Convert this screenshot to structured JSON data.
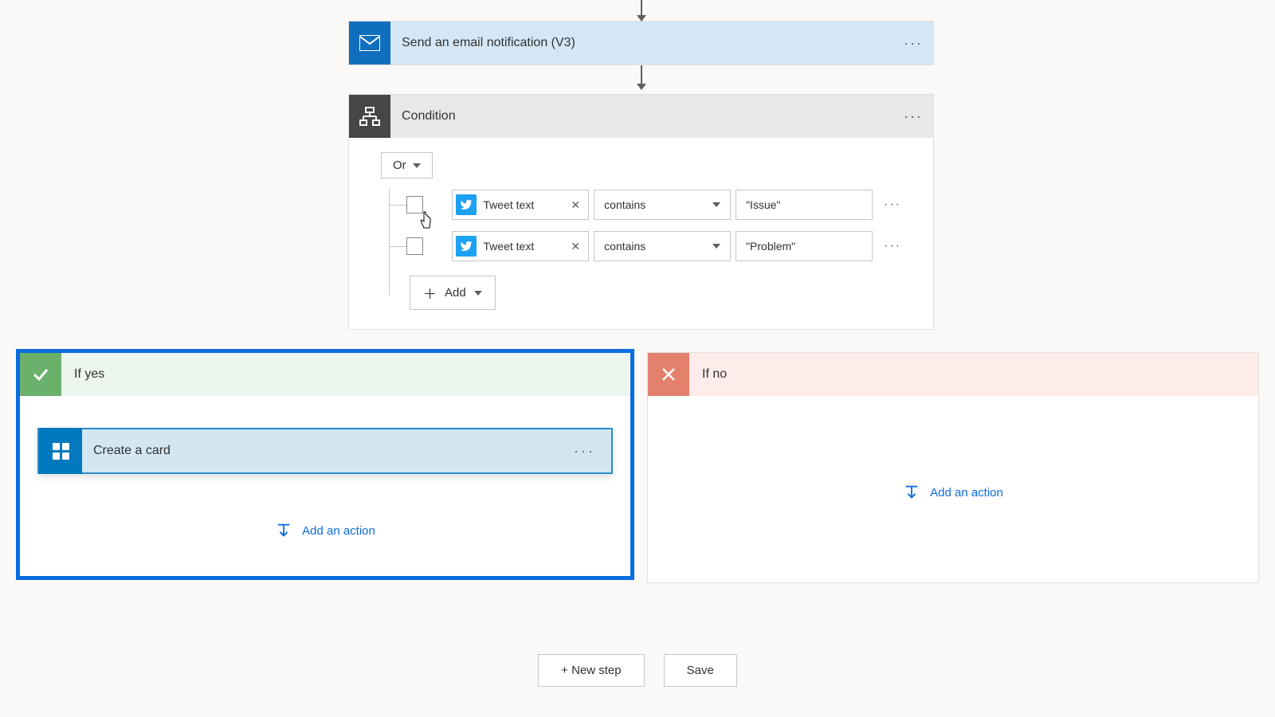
{
  "email_step": {
    "title": "Send an email notification (V3)"
  },
  "condition": {
    "title": "Condition",
    "logic": "Or",
    "add_label": "Add",
    "rows": [
      {
        "token": "Tweet text",
        "operator": "contains",
        "value": "\"Issue\""
      },
      {
        "token": "Tweet text",
        "operator": "contains",
        "value": "\"Problem\""
      }
    ]
  },
  "branches": {
    "yes": {
      "title": "If yes",
      "action": "Create a card",
      "add_action": "Add an action"
    },
    "no": {
      "title": "If no",
      "add_action": "Add an action"
    }
  },
  "footer": {
    "new_step": "+ New step",
    "save": "Save"
  }
}
